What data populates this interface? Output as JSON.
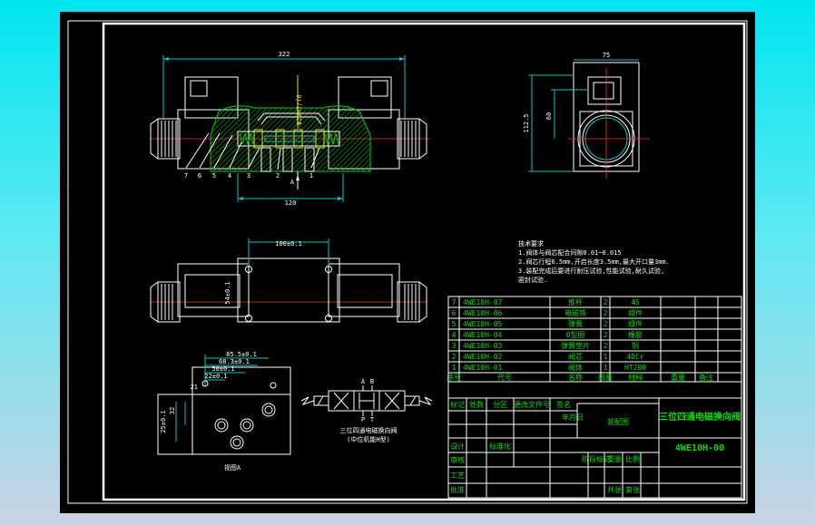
{
  "drawing_title": "三位四通电磁换向阀",
  "drawing_number": "4WE10H-00",
  "drawing_type": "装配图",
  "dims": {
    "top_width": "322",
    "right_width": "75",
    "right_height": "112.5",
    "right_height_inner": "60",
    "bore": "Φ20H7/f6",
    "bottom_width": "120",
    "plan_pitch": "100±0.1",
    "plan_vert": "54±0.1",
    "port_a": "85.5±0.1",
    "port_b": "68.3±0.1",
    "port_c": "50±0.1",
    "port_d": "22±0.1",
    "port_e": "21",
    "port_f": "32",
    "port_g": "25±0.1"
  },
  "section_label": "A",
  "balloons": [
    "7",
    "6",
    "5",
    "4",
    "3",
    "2",
    "1"
  ],
  "view_label": "视图A",
  "tech_req": {
    "title": "技术要求",
    "lines": [
      "1.阀体与阀芯配合间隙0.01~0.015",
      "2.阀芯行程6.5mm,开启长度3.5mm,最大开口量3mm.",
      "3.装配完成后要进行耐压试验,性能试验,耐久试验,",
      "  密封试验."
    ]
  },
  "symbol": {
    "ports_top": [
      "A",
      "B"
    ],
    "ports_bottom": [
      "P",
      "T"
    ],
    "caption1": "三位四通电磁换向阀",
    "caption2": "(中位机能H型)"
  },
  "bom": [
    {
      "no": "7",
      "code": "4WE10H-07",
      "name": "推杆",
      "qty": "2",
      "material": "45"
    },
    {
      "no": "6",
      "code": "4WE10H-06",
      "name": "电磁铁",
      "qty": "2",
      "material": "组件"
    },
    {
      "no": "5",
      "code": "4WE10H-05",
      "name": "弹簧",
      "qty": "2",
      "material": "组件"
    },
    {
      "no": "4",
      "code": "4WE10H-04",
      "name": "O型圈",
      "qty": "2",
      "material": "橡胶"
    },
    {
      "no": "3",
      "code": "4WE10H-03",
      "name": "弹簧垫片",
      "qty": "2",
      "material": "铜"
    },
    {
      "no": "2",
      "code": "4WE10H-02",
      "name": "阀芯",
      "qty": "1",
      "material": "40Cr"
    },
    {
      "no": "1",
      "code": "4WE10H-01",
      "name": "阀体",
      "qty": "1",
      "material": "HT200"
    }
  ],
  "bom_header": [
    "序号",
    "代号",
    "名称",
    "数量",
    "材料",
    "重量",
    "备注"
  ],
  "title_block_labels": [
    "标记",
    "处数",
    "分区",
    "更改文件号",
    "签名",
    "年月日",
    "设计",
    "标准化",
    "阶段标记",
    "重量",
    "比例",
    "审核",
    "工艺",
    "批准",
    "共张",
    "第张"
  ]
}
